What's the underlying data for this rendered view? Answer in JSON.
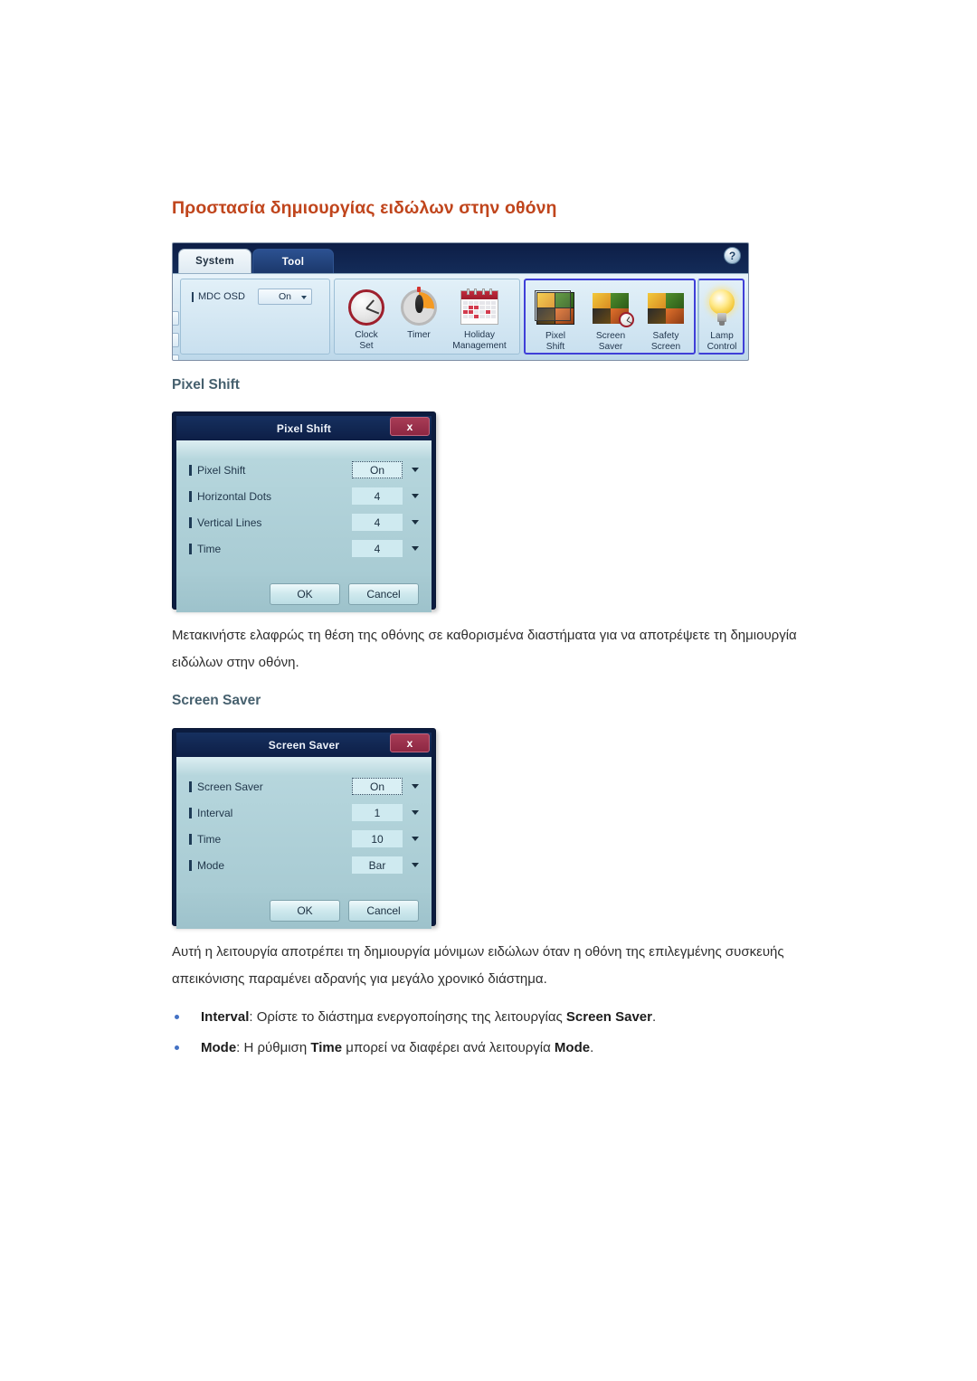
{
  "page": {
    "title": "Προστασία δημιουργίας ειδώλων στην οθόνη",
    "title_color": "#C0451C"
  },
  "mdc_toolbar": {
    "tabs": [
      {
        "label": "System",
        "active": true
      },
      {
        "label": "Tool",
        "active": false
      }
    ],
    "help_icon": "?",
    "osd": {
      "label": "MDC OSD",
      "value": "On"
    },
    "groups": [
      {
        "name": "clock-group",
        "highlighted": false,
        "tools": [
          {
            "icon": "clock-icon",
            "line1": "Clock",
            "line2": "Set"
          },
          {
            "icon": "timer-icon",
            "line1": "Timer",
            "line2": ""
          },
          {
            "icon": "calendar-icon",
            "line1": "Holiday",
            "line2": "Management"
          }
        ]
      },
      {
        "name": "screen-group",
        "highlighted": true,
        "tools": [
          {
            "icon": "pixel-shift-icon",
            "line1": "Pixel",
            "line2": "Shift"
          },
          {
            "icon": "screen-saver-icon",
            "line1": "Screen",
            "line2": "Saver"
          },
          {
            "icon": "safety-screen-icon",
            "line1": "Safety",
            "line2": "Screen"
          }
        ]
      },
      {
        "name": "lamp-group",
        "highlighted": true,
        "tools": [
          {
            "icon": "lamp-icon",
            "line1": "Lamp",
            "line2": "Control"
          }
        ]
      }
    ]
  },
  "pixel_shift_section": {
    "heading": "Pixel Shift",
    "dialog": {
      "title": "Pixel Shift",
      "close_label": "x",
      "rows": [
        {
          "label": "Pixel Shift",
          "value": "On",
          "focused": true
        },
        {
          "label": "Horizontal Dots",
          "value": "4",
          "focused": false
        },
        {
          "label": "Vertical Lines",
          "value": "4",
          "focused": false
        },
        {
          "label": "Time",
          "value": "4",
          "focused": false
        }
      ],
      "ok_label": "OK",
      "cancel_label": "Cancel"
    },
    "paragraph": "Μετακινήστε ελαφρώς τη θέση της οθόνης σε καθορισμένα διαστήματα για να αποτρέψετε τη δημιουργία ειδώλων στην οθόνη."
  },
  "screen_saver_section": {
    "heading": "Screen Saver",
    "dialog": {
      "title": "Screen Saver",
      "close_label": "x",
      "rows": [
        {
          "label": "Screen Saver",
          "value": "On",
          "focused": true
        },
        {
          "label": "Interval",
          "value": "1",
          "focused": false
        },
        {
          "label": "Time",
          "value": "10",
          "focused": false
        },
        {
          "label": "Mode",
          "value": "Bar",
          "focused": false
        }
      ],
      "ok_label": "OK",
      "cancel_label": "Cancel"
    },
    "paragraph": "Αυτή η λειτουργία αποτρέπει τη δημιουργία μόνιμων ειδώλων όταν η οθόνη της επιλεγμένης συσκευής απεικόνισης παραμένει αδρανής για μεγάλο χρονικό διάστημα.",
    "bullets": [
      {
        "lead": "Interval",
        "mid": ": Ορίστε το διάστημα ενεργοποίησης της λειτουργίας ",
        "strong": "Screen Saver",
        "tail": "."
      },
      {
        "lead": "Mode",
        "mid": ": Η ρύθμιση ",
        "strong": "Time",
        "mid2": " μπορεί να διαφέρει ανά λειτουργία ",
        "strong2": "Mode",
        "tail": "."
      }
    ]
  }
}
